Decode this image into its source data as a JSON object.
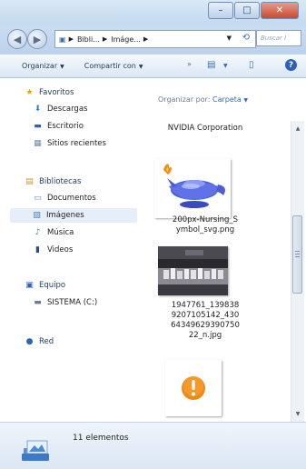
{
  "window": {
    "minimize_icon": "minimize-icon",
    "maximize_icon": "maximize-icon",
    "close_icon": "close-icon"
  },
  "navigation": {
    "back_icon": "back-arrow-icon",
    "forward_icon": "forward-arrow-icon",
    "path": [
      "Bibli...",
      "Imáge..."
    ],
    "search_placeholder": "Buscar I"
  },
  "toolbar": {
    "organize_label": "Organizar",
    "share_label": "Compartir con"
  },
  "sidebar": {
    "favorites_label": "Favoritos",
    "favorites": [
      {
        "label": "Descargas",
        "icon": "downloads-icon"
      },
      {
        "label": "Escritorio",
        "icon": "desktop-icon"
      },
      {
        "label": "Sitios recientes",
        "icon": "recent-places-icon"
      }
    ],
    "libraries_label": "Bibliotecas",
    "libraries": [
      {
        "label": "Documentos",
        "icon": "documents-icon"
      },
      {
        "label": "Imágenes",
        "icon": "pictures-icon",
        "selected": true
      },
      {
        "label": "Música",
        "icon": "music-icon"
      },
      {
        "label": "Videos",
        "icon": "videos-icon"
      }
    ],
    "computer_label": "Equipo",
    "computer": [
      {
        "label": "SISTEMA (C:)",
        "icon": "drive-icon"
      }
    ],
    "network_label": "Red"
  },
  "content": {
    "arrange_by_label": "Organizar por:",
    "arrange_by_value": "Carpeta",
    "items": [
      {
        "name": "NVIDIA Corporation",
        "type": "folder"
      },
      {
        "name": "200px-Nursing_Symbol_svg.png",
        "display_lines": [
          "200px-Nursing_S",
          "ymbol_svg.png"
        ],
        "type": "image"
      },
      {
        "name": "1947761_1398389207105142_43064349629390750 22_n.jpg",
        "display_lines": [
          "1947761_139838",
          "9207105142_430",
          "64349629390750",
          "22_n.jpg"
        ],
        "type": "image"
      },
      {
        "name": "",
        "type": "image"
      }
    ]
  },
  "details": {
    "count": "11 elementos"
  },
  "colors": {
    "accent": "#2b6cc4",
    "selected_bg": "#e5eef9",
    "titlebar": "#c9ddf1",
    "close_button": "#c94a33"
  }
}
